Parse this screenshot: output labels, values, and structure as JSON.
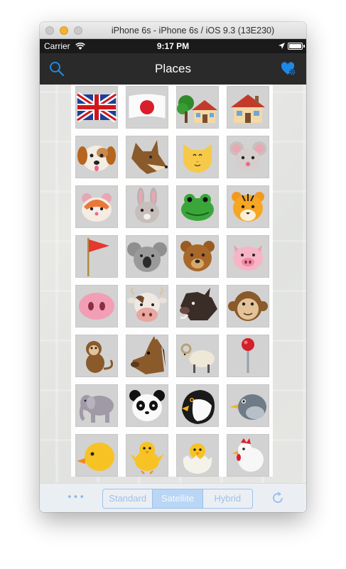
{
  "window": {
    "title": "iPhone 6s - iPhone 6s / iOS 9.3 (13E230)"
  },
  "status_bar": {
    "carrier": "Carrier",
    "time": "9:17 PM",
    "battery_level": 1.0
  },
  "nav_bar": {
    "title": "Places",
    "left_icon": "search-icon",
    "right_icon": "heart-gear-icon"
  },
  "places": [
    {
      "icon": "uk-flag"
    },
    {
      "icon": "japan-flag"
    },
    {
      "icon": "house-with-garden"
    },
    {
      "icon": "house"
    },
    {
      "icon": "dog-face"
    },
    {
      "icon": "wolf-face"
    },
    {
      "icon": "cat-face"
    },
    {
      "icon": "mouse-face"
    },
    {
      "icon": "hamster-face"
    },
    {
      "icon": "rabbit-face"
    },
    {
      "icon": "frog-face"
    },
    {
      "icon": "tiger-face"
    },
    {
      "icon": "triangular-flag"
    },
    {
      "icon": "koala-face"
    },
    {
      "icon": "bear-face"
    },
    {
      "icon": "pig-face"
    },
    {
      "icon": "pig-nose"
    },
    {
      "icon": "cow-face"
    },
    {
      "icon": "boar"
    },
    {
      "icon": "monkey-face"
    },
    {
      "icon": "monkey"
    },
    {
      "icon": "horse-face"
    },
    {
      "icon": "ram"
    },
    {
      "icon": "round-pushpin"
    },
    {
      "icon": "elephant"
    },
    {
      "icon": "panda-face"
    },
    {
      "icon": "penguin"
    },
    {
      "icon": "bird"
    },
    {
      "icon": "baby-chick"
    },
    {
      "icon": "front-facing-chick"
    },
    {
      "icon": "hatching-chick"
    },
    {
      "icon": "rooster"
    }
  ],
  "toolbar": {
    "more_label": "•••",
    "map_types": [
      "Standard",
      "Satellite",
      "Hybrid"
    ],
    "selected_map_type": "Satellite",
    "refresh_icon": "refresh-icon"
  },
  "colors": {
    "tint": "#1e88e5",
    "nav_background": "#2a2a2a"
  }
}
